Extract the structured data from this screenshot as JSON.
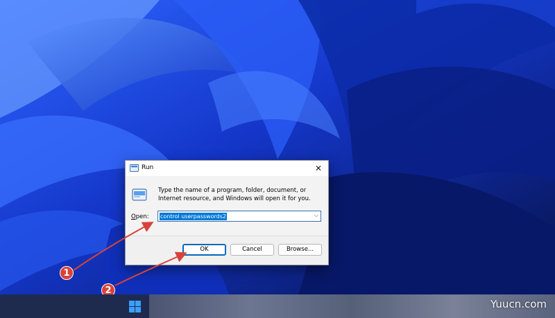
{
  "run_dialog": {
    "title": "Run",
    "description": "Type the name of a program, folder, document, or Internet resource, and Windows will open it for you.",
    "open_label_prefix": "O",
    "open_label_rest": "pen:",
    "open_value": "control userpasswords2",
    "ok_label": "OK",
    "cancel_label": "Cancel",
    "browse_label": "Browse...",
    "close_glyph": "✕"
  },
  "callouts": {
    "first": "1",
    "second": "2"
  },
  "watermark": "Yuucn.com",
  "colors": {
    "accent": "#0078d7",
    "callout": "#d84339",
    "wallpaper": "#1a3fd8"
  }
}
